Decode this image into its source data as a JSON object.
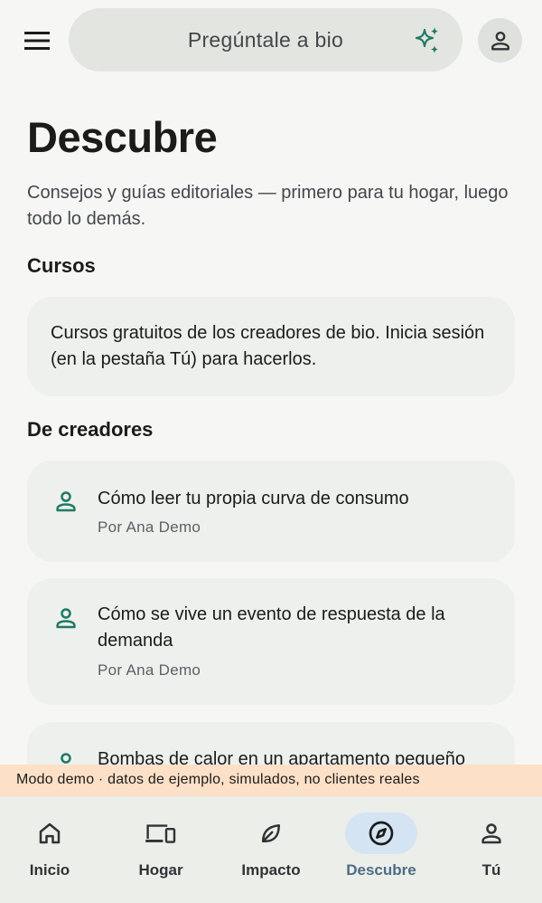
{
  "colors": {
    "accent": "#1f7a63",
    "nav_active_bg": "#d4e4f2",
    "nav_active_text": "#4f6b86",
    "demo_banner_bg": "#fde0c8"
  },
  "header": {
    "menu_icon": "menu-icon",
    "search": {
      "placeholder": "Pregúntale a bio",
      "icon": "sparkle-icon"
    },
    "account_icon": "person-icon"
  },
  "page": {
    "title": "Descubre",
    "intro": "Consejos y guías editoriales — primero para tu hogar, luego todo lo demás."
  },
  "courses": {
    "heading": "Cursos",
    "text": "Cursos gratuitos de los creadores de bio. Inicia sesión (en la pestaña Tú) para hacerlos."
  },
  "creators": {
    "heading": "De creadores",
    "items": [
      {
        "title": "Cómo leer tu propia curva de consumo",
        "author": "Por Ana Demo",
        "icon": "person-icon"
      },
      {
        "title": "Cómo se vive un evento de respuesta de la demanda",
        "author": "Por Ana Demo",
        "icon": "person-icon"
      },
      {
        "title": "Bombas de calor en un apartamento pequeño",
        "author": "",
        "icon": "person-icon"
      }
    ]
  },
  "demo_banner": "Modo demo · datos de ejemplo, simulados, no clientes reales",
  "bottom_nav": {
    "items": [
      {
        "label": "Inicio",
        "icon": "home-icon",
        "active": false
      },
      {
        "label": "Hogar",
        "icon": "devices-icon",
        "active": false
      },
      {
        "label": "Impacto",
        "icon": "leaf-icon",
        "active": false
      },
      {
        "label": "Descubre",
        "icon": "compass-icon",
        "active": true
      },
      {
        "label": "Tú",
        "icon": "person-icon",
        "active": false
      }
    ]
  }
}
